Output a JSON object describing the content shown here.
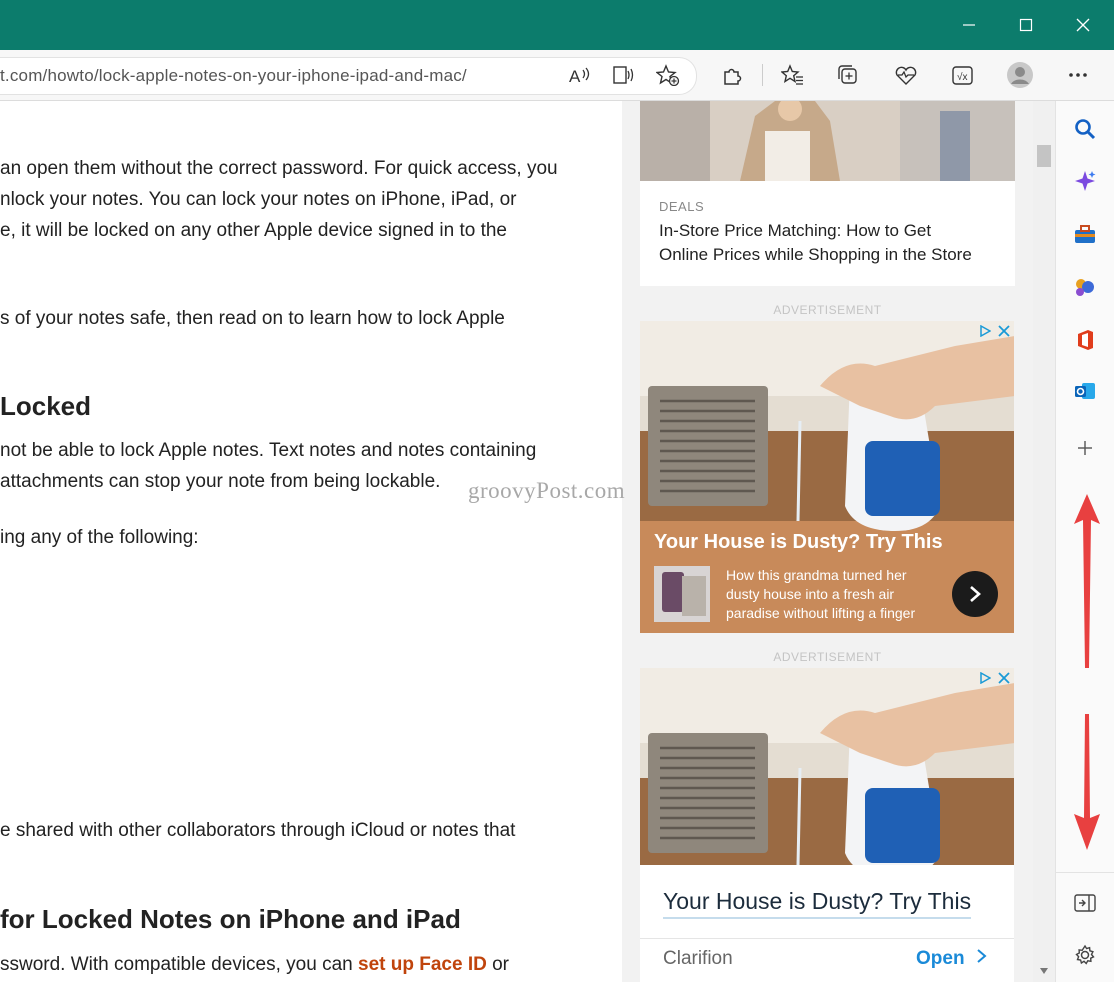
{
  "window": {
    "titlebar_color": "#0c7c6c",
    "minimize_icon": "minimize-icon",
    "maximize_icon": "maximize-icon",
    "close_icon": "close-icon"
  },
  "address_bar": {
    "url": "t.com/howto/lock-apple-notes-on-your-iphone-ipad-and-mac/"
  },
  "article": {
    "paragraph1": [
      "an open them without the correct password. For quick access, you",
      "nlock your notes. You can lock your notes on iPhone, iPad, or",
      "e, it will be locked on any other Apple device signed in to the"
    ],
    "paragraph2": "s of your notes safe, then read on to learn how to lock Apple",
    "heading1": " Locked",
    "paragraph3": [
      " not be able to lock Apple notes. Text notes and notes containing",
      "attachments can stop your note from being lockable."
    ],
    "paragraph4": "ing any of the following:",
    "paragraph5": "e shared with other collaborators through iCloud or notes that",
    "heading2": "for Locked Notes on iPhone and iPad",
    "paragraph6_start": "ssword. With compatible devices, you can ",
    "paragraph6_link": "set up Face ID",
    "paragraph6_end": " or",
    "watermark": "groovyPost.com"
  },
  "side": {
    "deal_category": "DEALS",
    "deal_title_line1": "In-Store Price Matching: How to Get",
    "deal_title_line2": "Online Prices while Shopping in the Store",
    "ad_label": "ADVERTISEMENT",
    "ad1": {
      "headline": "Your House is Dusty? Try This",
      "body_line1": "How this grandma turned her",
      "body_line2": "dusty house into a fresh air",
      "body_line3": "paradise without lifting a finger",
      "bg_color": "#c88a5a"
    },
    "ad_label2": "ADVERTISEMENT",
    "ad2": {
      "headline": "Your House is Dusty? Try This",
      "advertiser": "Clarifion",
      "cta": "Open"
    }
  },
  "annotation_color": "#e84040"
}
